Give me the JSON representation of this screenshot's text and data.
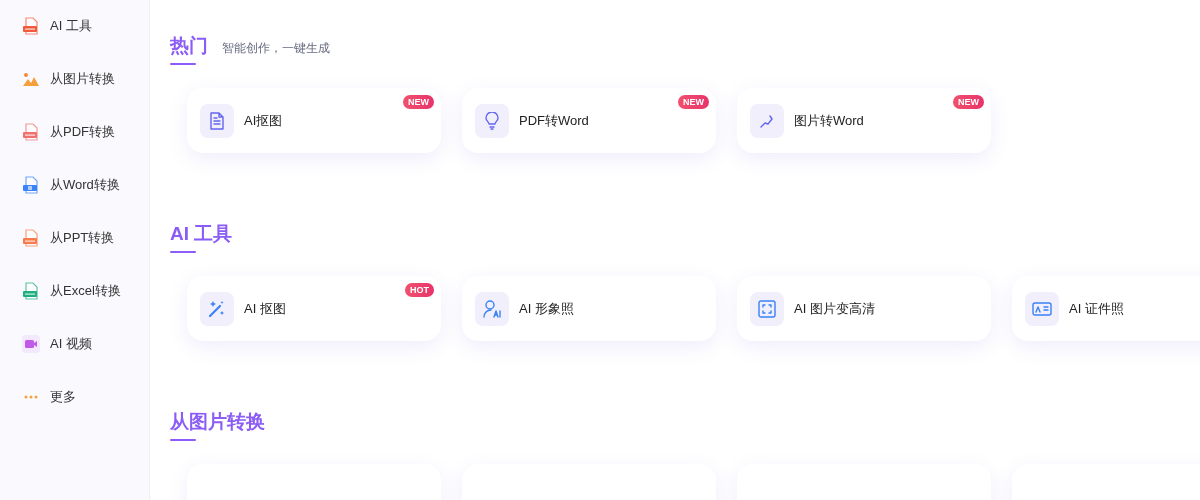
{
  "sidebar": {
    "items": [
      {
        "label": "AI 工具",
        "kind": "ai"
      },
      {
        "label": "从图片转换",
        "kind": "image"
      },
      {
        "label": "从PDF转换",
        "kind": "pdf"
      },
      {
        "label": "从Word转换",
        "kind": "word"
      },
      {
        "label": "从PPT转换",
        "kind": "ppt"
      },
      {
        "label": "从Excel转换",
        "kind": "excel"
      },
      {
        "label": "AI 视频",
        "kind": "video"
      },
      {
        "label": "更多",
        "kind": "more"
      }
    ]
  },
  "sections": [
    {
      "title": "热门",
      "subtitle": "智能创作，一键生成",
      "cards": [
        {
          "label": "AI抠图",
          "kind": "document",
          "badge": "NEW"
        },
        {
          "label": "PDF转Word",
          "kind": "bulb",
          "badge": "NEW"
        },
        {
          "label": "图片转Word",
          "kind": "pen",
          "badge": "NEW"
        }
      ]
    },
    {
      "title": "AI 工具",
      "cards": [
        {
          "label": "AI 抠图",
          "kind": "wand",
          "badge": "HOT"
        },
        {
          "label": "AI 形象照",
          "kind": "person"
        },
        {
          "label": "AI 图片变高清",
          "kind": "frame"
        },
        {
          "label": "AI 证件照",
          "kind": "idcard"
        }
      ]
    },
    {
      "title": "从图片转换"
    }
  ]
}
